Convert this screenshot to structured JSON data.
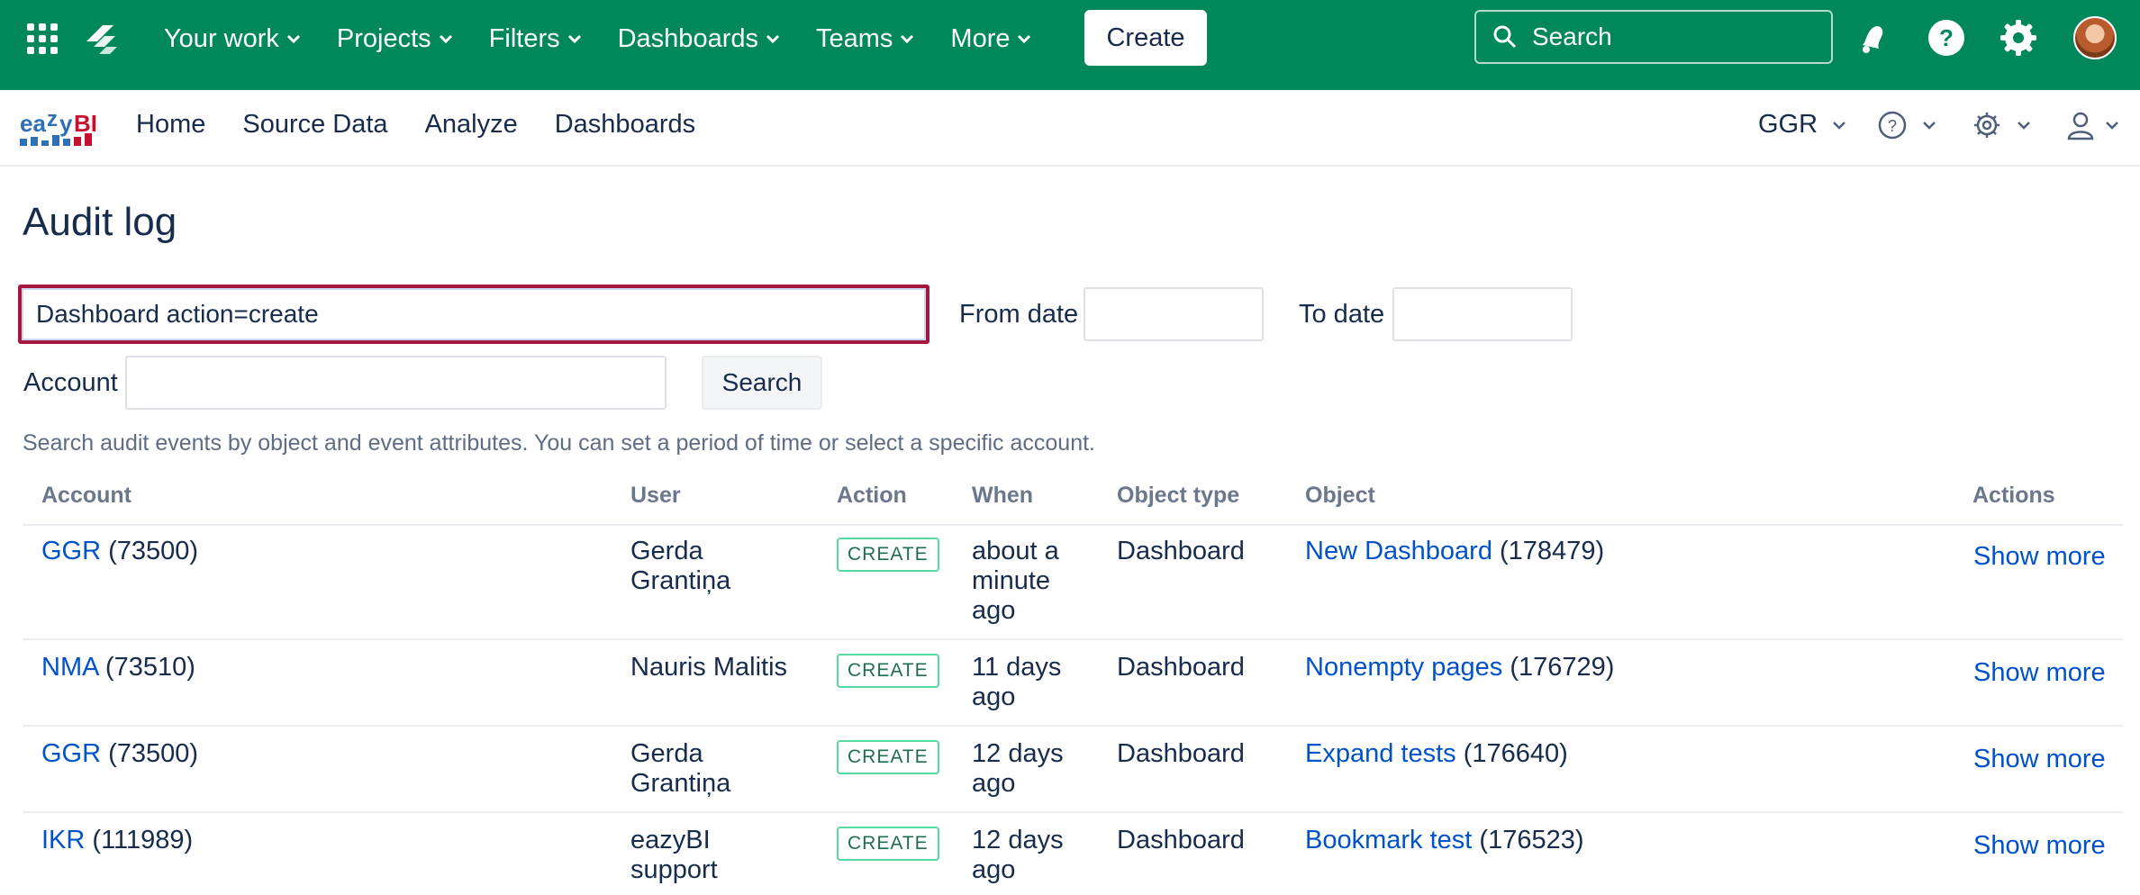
{
  "topbar": {
    "nav": [
      {
        "label": "Your work"
      },
      {
        "label": "Projects"
      },
      {
        "label": "Filters"
      },
      {
        "label": "Dashboards"
      },
      {
        "label": "Teams"
      },
      {
        "label": "More"
      }
    ],
    "create_label": "Create",
    "search_placeholder": "Search",
    "icons": [
      "app-switcher-icon",
      "jira-logo-icon",
      "notifications-icon",
      "help-icon",
      "settings-icon",
      "avatar"
    ],
    "bg_color": "#00875a"
  },
  "eazybi": {
    "logo_text": "eazyBI",
    "nav": [
      "Home",
      "Source Data",
      "Analyze",
      "Dashboards"
    ],
    "account_selector": "GGR"
  },
  "page": {
    "title": "Audit log",
    "query_value": "Dashboard action=create",
    "from_date_label": "From date",
    "to_date_label": "To date",
    "account_label": "Account",
    "search_button": "Search",
    "hint": "Search audit events by object and event attributes. You can set a period of time or select a specific account."
  },
  "table": {
    "headers": [
      "Account",
      "User",
      "Action",
      "When",
      "Object type",
      "Object",
      "Actions"
    ],
    "rows": [
      {
        "account": "GGR",
        "account_id": "(73500)",
        "user": [
          "Gerda",
          "Grantiņa"
        ],
        "action": "CREATE",
        "when": [
          "about a",
          "minute",
          "ago"
        ],
        "object_type": "Dashboard",
        "object": "New Dashboard",
        "object_id": "(178479)",
        "actions": "Show more"
      },
      {
        "account": "NMA",
        "account_id": "(73510)",
        "user": [
          "Nauris Malitis"
        ],
        "action": "CREATE",
        "when": [
          "11 days",
          "ago"
        ],
        "object_type": "Dashboard",
        "object": "Nonempty pages",
        "object_id": "(176729)",
        "actions": "Show more"
      },
      {
        "account": "GGR",
        "account_id": "(73500)",
        "user": [
          "Gerda",
          "Grantiņa"
        ],
        "action": "CREATE",
        "when": [
          "12 days",
          "ago"
        ],
        "object_type": "Dashboard",
        "object": "Expand tests",
        "object_id": "(176640)",
        "actions": "Show more"
      },
      {
        "account": "IKR",
        "account_id": "(111989)",
        "user": [
          "eazyBI",
          "support"
        ],
        "action": "CREATE",
        "when": [
          "12 days",
          "ago"
        ],
        "object_type": "Dashboard",
        "object": "Bookmark test",
        "object_id": "(176523)",
        "actions": "Show more"
      }
    ]
  }
}
